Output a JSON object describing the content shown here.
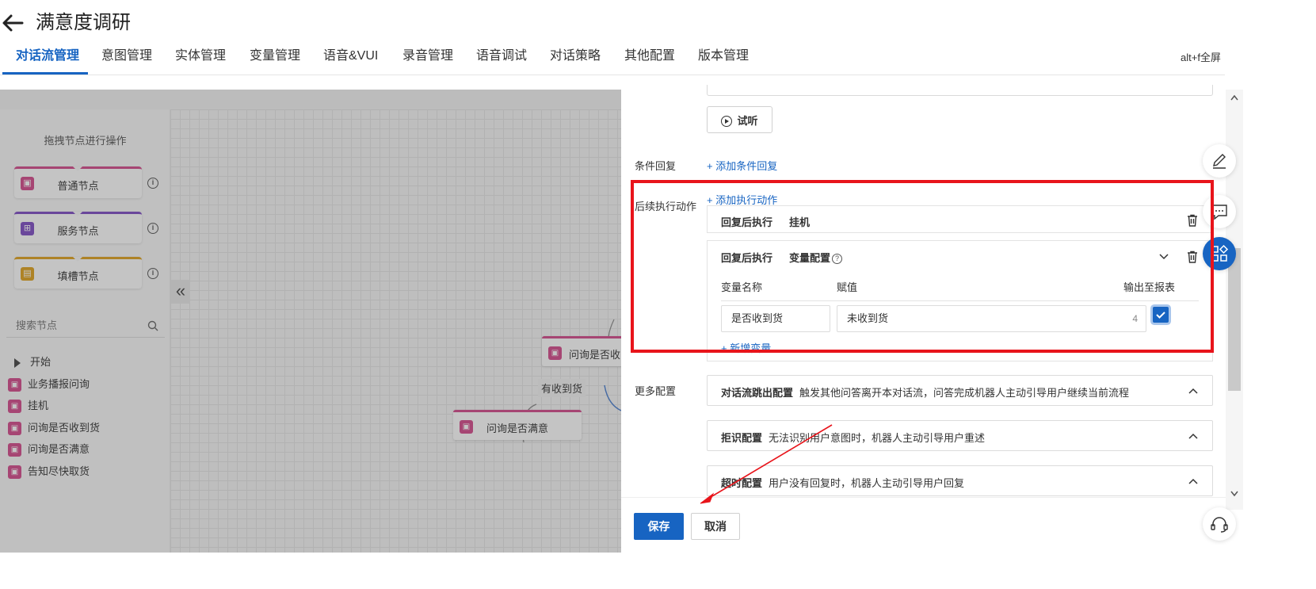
{
  "header": {
    "title": "满意度调研",
    "fullscreen_hint": "alt+f全屏"
  },
  "tabs": [
    {
      "label": "对话流管理",
      "active": true
    },
    {
      "label": "意图管理"
    },
    {
      "label": "实体管理"
    },
    {
      "label": "变量管理"
    },
    {
      "label": "语音&VUI"
    },
    {
      "label": "录音管理"
    },
    {
      "label": "语音调试"
    },
    {
      "label": "对话策略"
    },
    {
      "label": "其他配置"
    },
    {
      "label": "版本管理"
    }
  ],
  "palette": {
    "hint": "拖拽节点进行操作",
    "node_types": [
      {
        "label": "普通节点",
        "color": "#d54a8b",
        "icon": "robot-icon"
      },
      {
        "label": "服务节点",
        "color": "#7e4cc4",
        "icon": "service-icon"
      },
      {
        "label": "填槽节点",
        "color": "#e0a21e",
        "icon": "form-icon"
      }
    ],
    "search_placeholder": "搜索节点",
    "tree_root": "开始",
    "tree_items": [
      "业务播报问询",
      "挂机",
      "问询是否收到货",
      "问询是否满意",
      "告知尽快取货"
    ]
  },
  "flow": {
    "nodes": [
      "问询是否收",
      "问询是否满意"
    ],
    "edge_label": "有收到货"
  },
  "config": {
    "listen_button": "试听",
    "condition_reply_label": "条件回复",
    "add_condition_reply": "+ 添加条件回复",
    "followup_label": "后续执行动作",
    "add_action": "+ 添加执行动作",
    "actions": [
      {
        "title": "回复后执行",
        "value": "挂机"
      },
      {
        "title": "回复后执行",
        "value": "变量配置"
      }
    ],
    "variable_table": {
      "headers": [
        "变量名称",
        "赋值",
        "输出至报表"
      ],
      "rows": [
        {
          "name": "是否收到货",
          "value": "未收到货",
          "count": "4",
          "output": true
        }
      ],
      "add_variable": "+ 新增变量"
    },
    "more_label": "更多配置",
    "more_items": [
      {
        "title": "对话流跳出配置",
        "desc": "触发其他问答离开本对话流，问答完成机器人主动引导用户继续当前流程"
      },
      {
        "title": "拒识配置",
        "desc": "无法识别用户意图时，机器人主动引导用户重述"
      },
      {
        "title": "超时配置",
        "desc": "用户没有回复时，机器人主动引导用户回复"
      }
    ]
  },
  "footer": {
    "save": "保存",
    "cancel": "取消"
  },
  "colors": {
    "accent": "#1764c2",
    "annotation": "#e8141b",
    "node_pink": "#d54a8b"
  }
}
